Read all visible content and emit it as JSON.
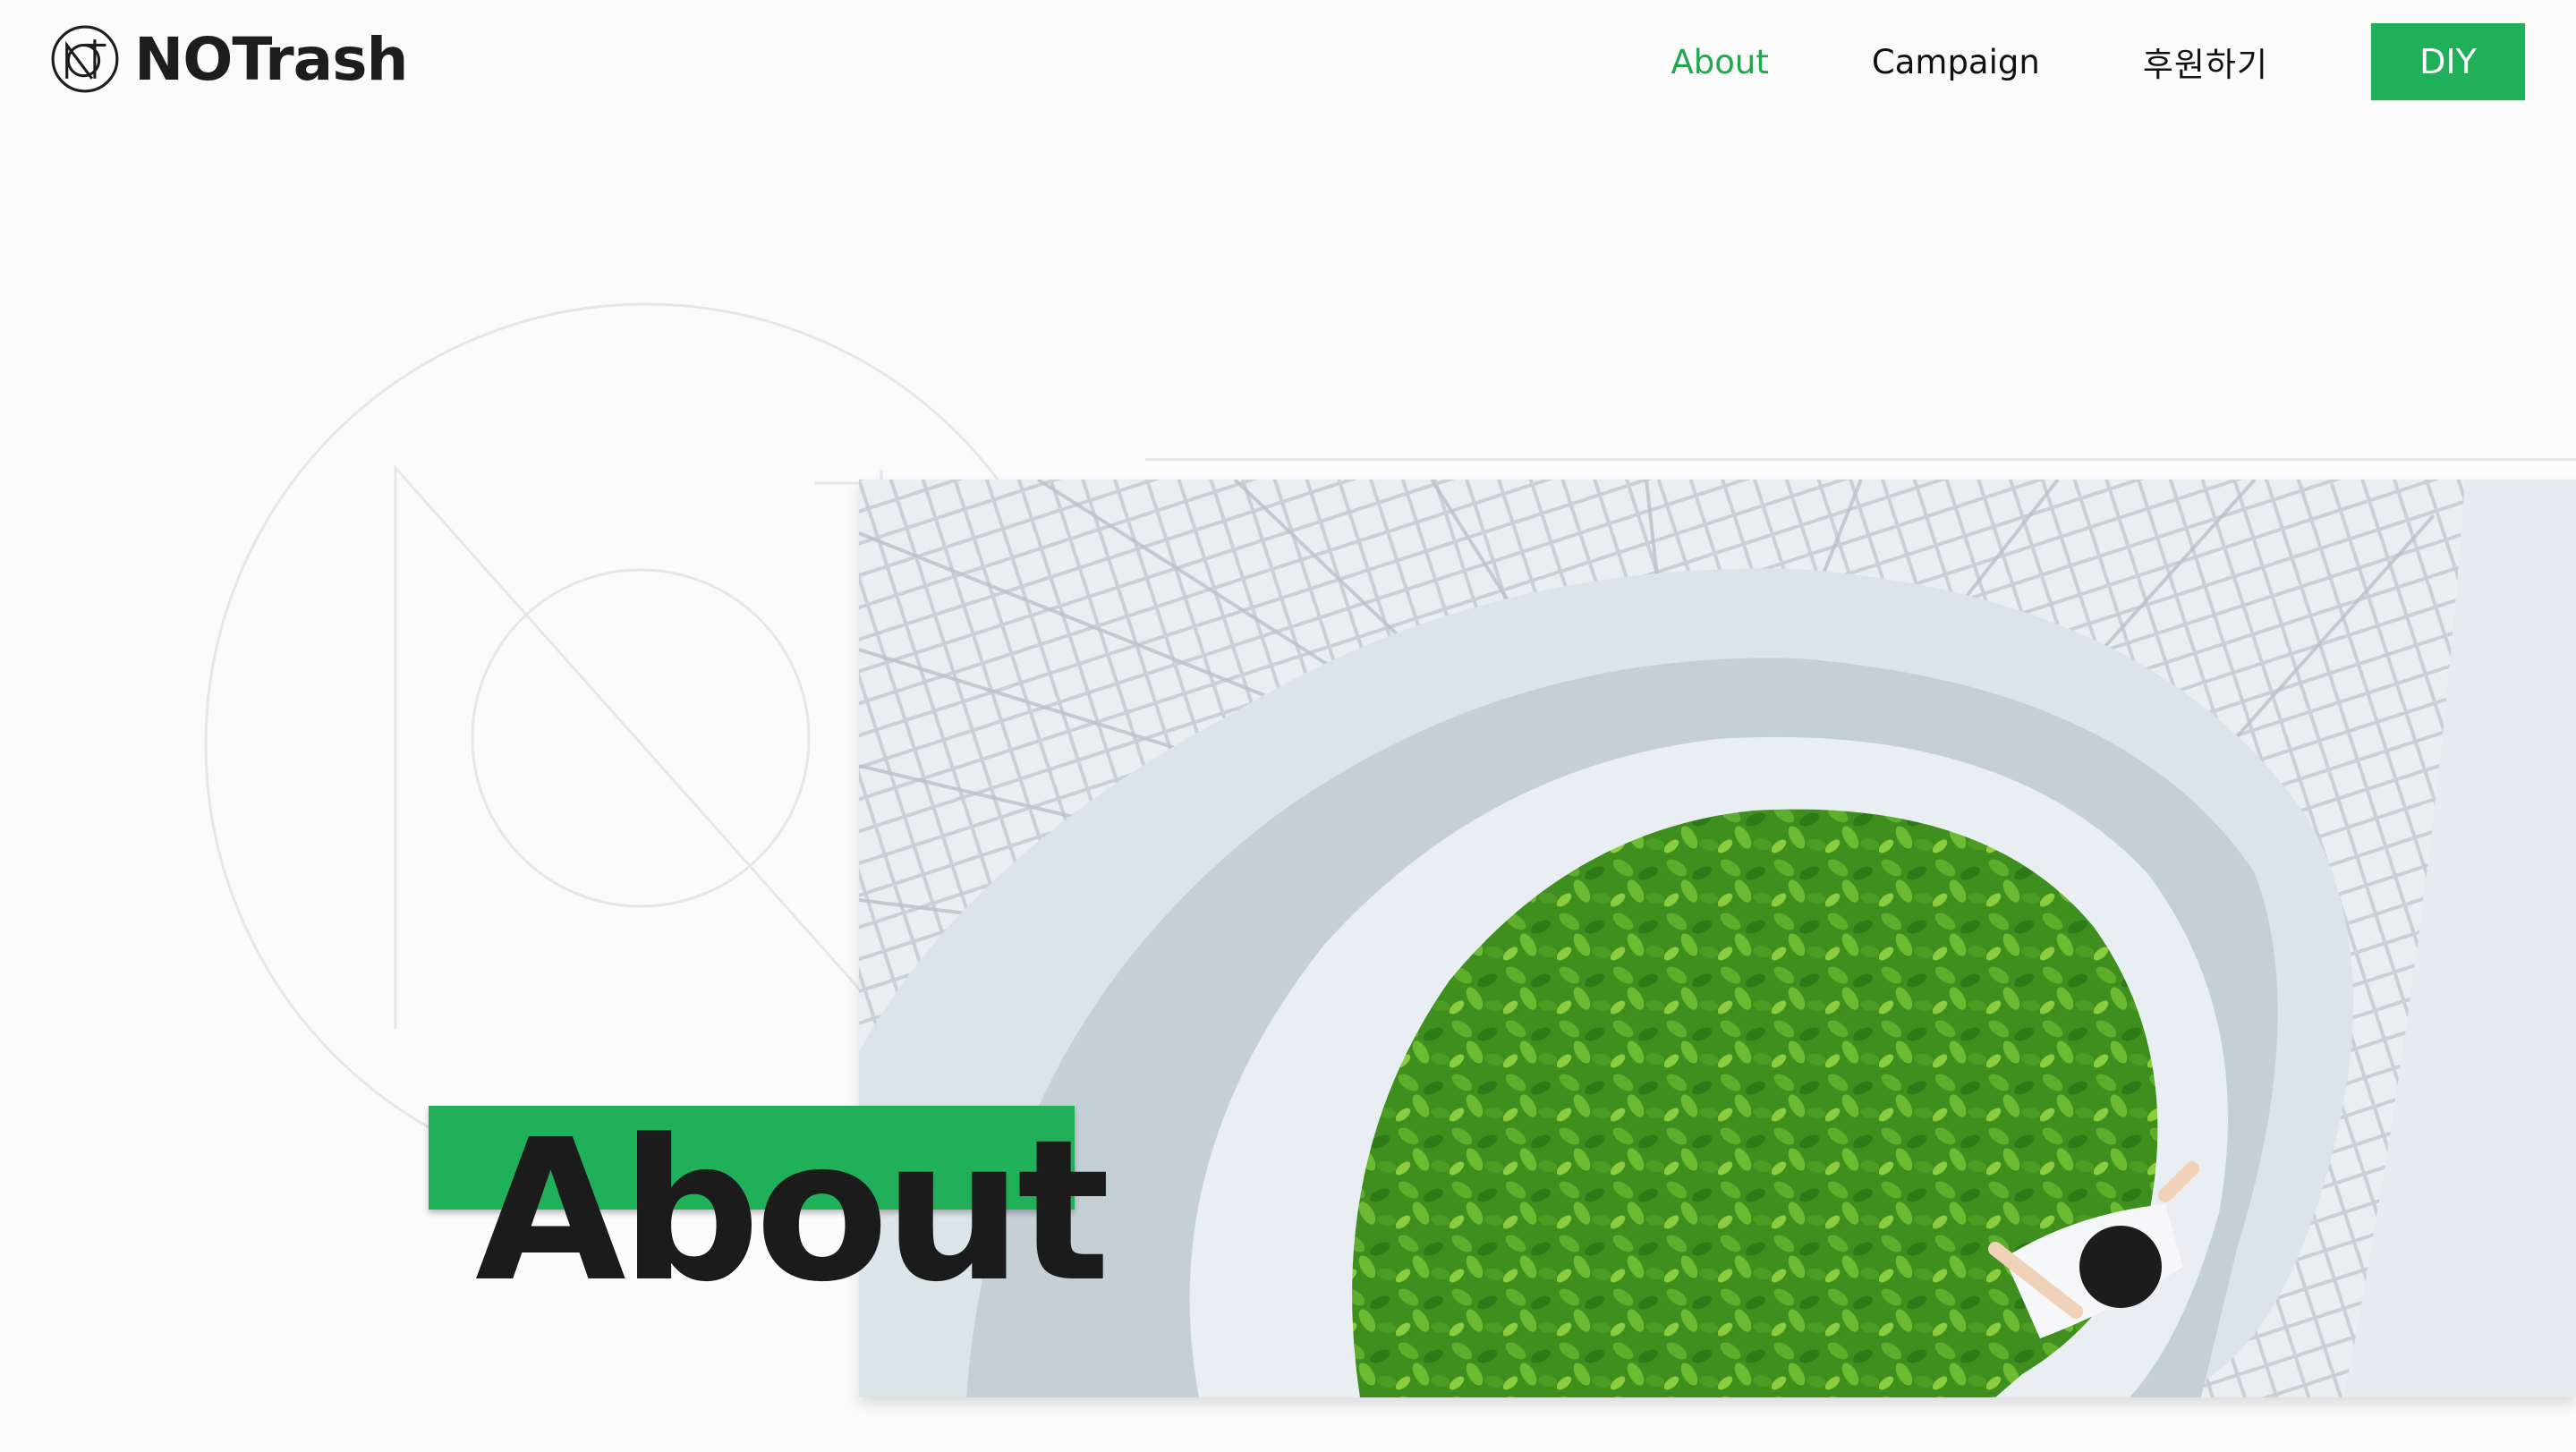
{
  "brand": {
    "name": "NOTrash",
    "icon": "notrash-logo-icon"
  },
  "nav": {
    "items": [
      {
        "label": "About",
        "active": true
      },
      {
        "label": "Campaign",
        "active": false
      },
      {
        "label": "후원하기",
        "active": false
      }
    ],
    "cta_label": "DIY"
  },
  "hero": {
    "title": "About",
    "image_description": "spiral-staircase-with-plants"
  },
  "colors": {
    "accent": "#21b05a",
    "active_link": "#21a84f",
    "text": "#1b1b1b",
    "background": "#fbfbfb"
  }
}
